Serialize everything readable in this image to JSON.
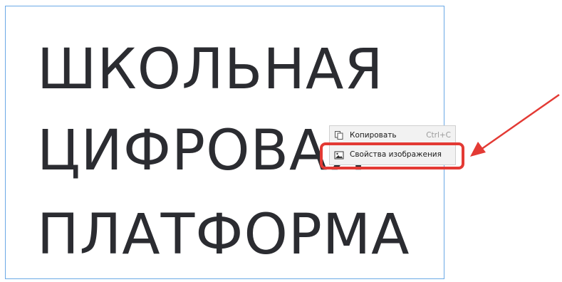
{
  "image": {
    "lines": [
      "ШКОЛЬНАЯ",
      "ЦИФРОВАЯ",
      "ПЛАТФОРМА"
    ]
  },
  "context_menu": {
    "items": [
      {
        "label": "Копировать",
        "shortcut": "Ctrl+C",
        "icon": "copy-icon"
      },
      {
        "label": "Свойства изображения",
        "icon": "image-icon"
      }
    ]
  },
  "annotation": {
    "highlight_color": "#e33a34",
    "arrow_color": "#e33a34"
  }
}
